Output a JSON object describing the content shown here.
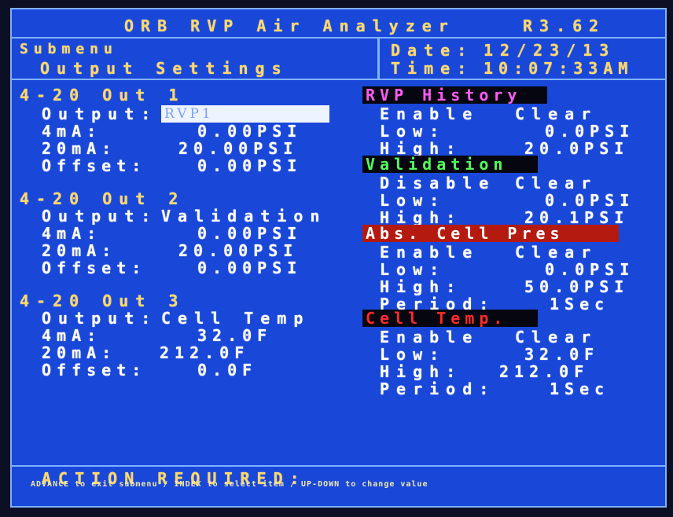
{
  "header": {
    "title": "ORB RVP Air Analyzer",
    "version": "R3.62"
  },
  "submenu": {
    "label": "Submenu",
    "name": "Output Settings"
  },
  "datetime": {
    "date_label": "Date:",
    "date_value": "12/23/13",
    "time_label": "Time:",
    "time_value": "10:07:33AM"
  },
  "outputs": [
    {
      "title": "4-20 Out 1",
      "output_label": "Output:",
      "output_value": "RVP1",
      "ma4_label": "4mA:",
      "ma4_value": "0.00PSI",
      "ma20_label": "20mA:",
      "ma20_value": "20.00PSI",
      "offset_label": "Offset:",
      "offset_value": "0.00PSI"
    },
    {
      "title": "4-20 Out 2",
      "output_label": "Output:",
      "output_value": "Validation",
      "ma4_label": "4mA:",
      "ma4_value": "0.00PSI",
      "ma20_label": "20mA:",
      "ma20_value": "20.00PSI",
      "offset_label": "Offset:",
      "offset_value": "0.00PSI"
    },
    {
      "title": "4-20 Out 3",
      "output_label": "Output:",
      "output_value": "Cell Temp",
      "ma4_label": "4mA:",
      "ma4_value": "32.0F",
      "ma20_label": "20mA:",
      "ma20_value": "212.0F",
      "offset_label": "Offset:",
      "offset_value": "0.0F"
    }
  ],
  "panels": {
    "rvp_history": {
      "title": "RVP History",
      "state": "Enable",
      "action": "Clear",
      "low_label": "Low:",
      "low_value": "0.0PSI",
      "high_label": "High:",
      "high_value": "20.0PSI"
    },
    "validation": {
      "title": "Validation",
      "state": "Disable",
      "action": "Clear",
      "low_label": "Low:",
      "low_value": "0.0PSI",
      "high_label": "High:",
      "high_value": "20.1PSI"
    },
    "abs_cell_pres": {
      "title": "Abs. Cell Pres",
      "state": "Enable",
      "action": "Clear",
      "low_label": "Low:",
      "low_value": "0.0PSI",
      "high_label": "High:",
      "high_value": "50.0PSI",
      "period_label": "Period:",
      "period_value": "1Sec"
    },
    "cell_temp": {
      "title": "Cell Temp.",
      "state": "Enable",
      "action": "Clear",
      "low_label": "Low:",
      "low_value": "32.0F",
      "high_label": "High:",
      "high_value": "212.0F",
      "period_label": "Period:",
      "period_value": "1Sec"
    }
  },
  "footer": {
    "action_required": "ACTION REQUIRED:",
    "instructions": "ADVANCE to exit submenu / INDEX to select item / UP-DOWN to change value"
  },
  "colors": {
    "background": "#1947d8",
    "border": "#7fb2ff",
    "accent": "#ffd86a"
  }
}
